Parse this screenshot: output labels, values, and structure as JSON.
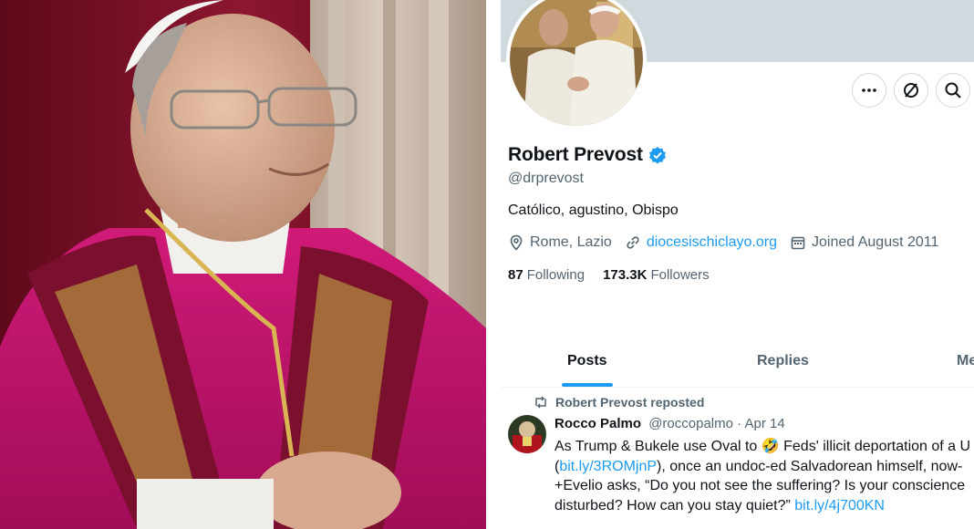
{
  "profile": {
    "display_name": "Robert Prevost",
    "handle": "@drprevost",
    "bio": "Católico, agustino, Obispo",
    "location": "Rome, Lazio",
    "website": "diocesischiclayo.org",
    "joined": "Joined August 2011",
    "following_count": "87",
    "following_label": "Following",
    "followers_count": "173.3K",
    "followers_label": "Followers"
  },
  "tabs": [
    "Posts",
    "Replies",
    "Me"
  ],
  "post": {
    "repost_label": "Robert Prevost reposted",
    "author": "Rocco Palmo",
    "author_handle": "@roccopalmo",
    "date": "· Apr 14",
    "line1_a": "As Trump & Bukele use Oval to ",
    "emoji": "🤣",
    "line1_b": " Feds' illicit deportation of a U",
    "line2_link": "bit.ly/3ROMjnP",
    "line2_text": "), once an undoc-ed Salvadorean himself, now-",
    "line2_open": "(",
    "line3": "+Evelio asks, “Do you not see the suffering? Is your conscience",
    "line4_text": "disturbed? How can you stay quiet?” ",
    "line4_link": "bit.ly/4j700KN"
  },
  "icons": {
    "more": "more-icon",
    "grok": "grok-icon",
    "search": "search-icon",
    "verified": "verified-badge-icon",
    "location": "location-pin-icon",
    "link": "link-icon",
    "calendar": "calendar-icon",
    "repost": "repost-icon"
  },
  "colors": {
    "accent": "#1d9bf0",
    "vestment_red": "#c4146e",
    "banner": "#cfd9de",
    "secondary_text": "#536471"
  }
}
